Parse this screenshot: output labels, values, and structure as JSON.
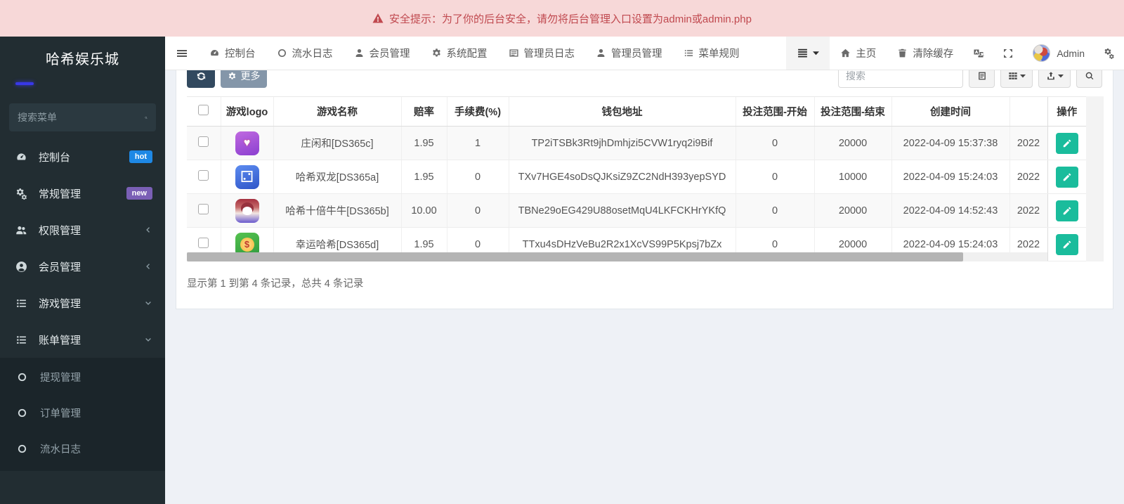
{
  "banner": {
    "text": "安全提示：为了你的后台安全，请勿将后台管理入口设置为admin或admin.php"
  },
  "sidebar": {
    "title": "哈希娱乐城",
    "search_placeholder": "搜索菜单",
    "items": [
      {
        "label": "控制台",
        "icon": "tachometer-icon",
        "badge": "hot"
      },
      {
        "label": "常规管理",
        "icon": "cogs-icon",
        "badge": "new"
      },
      {
        "label": "权限管理",
        "icon": "users-icon",
        "chevron": "left"
      },
      {
        "label": "会员管理",
        "icon": "user-circle-icon",
        "chevron": "left"
      },
      {
        "label": "游戏管理",
        "icon": "list-icon",
        "chevron": "down"
      },
      {
        "label": "账单管理",
        "icon": "list-icon",
        "chevron": "down"
      }
    ],
    "subitems": [
      {
        "label": "提现管理",
        "icon": "circle-o-icon"
      },
      {
        "label": "订单管理",
        "icon": "circle-o-icon"
      },
      {
        "label": "流水日志",
        "icon": "circle-o-icon"
      }
    ]
  },
  "navbar": {
    "items": [
      {
        "label": "控制台",
        "icon": "tachometer-icon"
      },
      {
        "label": "流水日志",
        "icon": "circle-o-icon"
      },
      {
        "label": "会员管理",
        "icon": "user-icon"
      },
      {
        "label": "系统配置",
        "icon": "gear-icon"
      },
      {
        "label": "管理员日志",
        "icon": "list-alt-icon"
      },
      {
        "label": "管理员管理",
        "icon": "user-icon"
      },
      {
        "label": "菜单规则",
        "icon": "list-icon"
      }
    ],
    "home_label": "主页",
    "clear_cache_label": "清除缓存",
    "username": "Admin"
  },
  "toolbar": {
    "more_label": "更多",
    "search_placeholder": "搜索"
  },
  "table": {
    "headers": [
      "",
      "游戏logo",
      "游戏名称",
      "赔率",
      "手续费(%)",
      "钱包地址",
      "投注范围-开始",
      "投注范围-结束",
      "创建时间",
      "",
      "操作"
    ],
    "rows": [
      {
        "name": "庄闲和[DS365c]",
        "odds": "1.95",
        "fee": "1",
        "wallet": "TP2iTSBk3Rt9jhDmhjzi5CVW1ryq2i9Bif",
        "bet_start": "0",
        "bet_end": "20000",
        "created": "2022-04-09 15:37:38",
        "updated": "2022"
      },
      {
        "name": "哈希双龙[DS365a]",
        "odds": "1.95",
        "fee": "0",
        "wallet": "TXv7HGE4soDsQJKsiZ9ZC2NdH393yepSYD",
        "bet_start": "0",
        "bet_end": "10000",
        "created": "2022-04-09 15:24:03",
        "updated": "2022"
      },
      {
        "name": "哈希十倍牛牛[DS365b]",
        "odds": "10.00",
        "fee": "0",
        "wallet": "TBNe29oEG429U88osetMqU4LKFCKHrYKfQ",
        "bet_start": "0",
        "bet_end": "20000",
        "created": "2022-04-09 14:52:43",
        "updated": "2022"
      },
      {
        "name": "幸运哈希[DS365d]",
        "odds": "1.95",
        "fee": "0",
        "wallet": "TTxu4sDHzVeBu2R2x1XcVS99P5Kpsj7bZx",
        "bet_start": "0",
        "bet_end": "20000",
        "created": "2022-04-09 15:24:03",
        "updated": "2022"
      }
    ],
    "footer": "显示第 1 到第 4 条记录，总共 4 条记录"
  },
  "colors": {
    "hot_badge": "#1e88e5",
    "new_badge": "#7a5fb5",
    "edit_button": "#1abc9c",
    "banner_bg": "#f7d8d8",
    "banner_text": "#c0494f",
    "refresh_button": "#32495f",
    "more_button": "#8496a9",
    "sidebar_bg": "#222d32",
    "sidebar_submenu_bg": "#1b252a"
  }
}
